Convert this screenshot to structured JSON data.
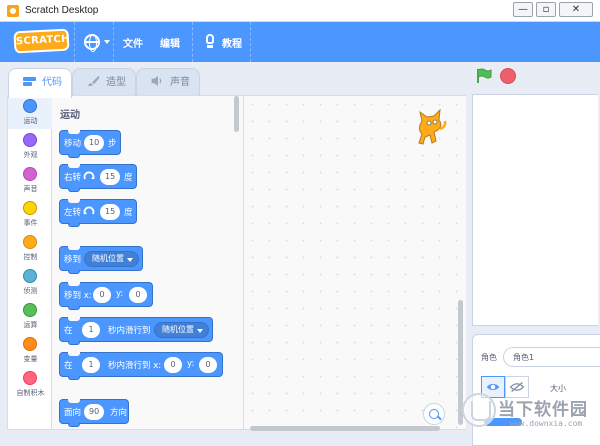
{
  "window": {
    "title": "Scratch Desktop",
    "minimize": "—",
    "maximize": "▫",
    "close": "✕"
  },
  "menubar": {
    "logo": "SCRATCH",
    "file": "文件",
    "edit": "编辑",
    "tutorials": "教程"
  },
  "tabs": [
    {
      "label": "代码"
    },
    {
      "label": "造型"
    },
    {
      "label": "声音"
    }
  ],
  "categories": [
    {
      "label": "运动",
      "color": "#4c97ff"
    },
    {
      "label": "外观",
      "color": "#9966ff"
    },
    {
      "label": "声音",
      "color": "#cf63cf"
    },
    {
      "label": "事件",
      "color": "#ffd500"
    },
    {
      "label": "控制",
      "color": "#ffab19"
    },
    {
      "label": "侦测",
      "color": "#5cb1d6"
    },
    {
      "label": "运算",
      "color": "#59c059"
    },
    {
      "label": "变量",
      "color": "#ff8c1a"
    },
    {
      "label": "自制积木",
      "color": "#ff6680"
    }
  ],
  "palette": {
    "section": "运动",
    "move": {
      "pre": "移动",
      "value": "10",
      "post": "步"
    },
    "turn_right": {
      "pre": "右转",
      "value": "15",
      "post": "度"
    },
    "turn_left": {
      "pre": "左转",
      "value": "15",
      "post": "度"
    },
    "goto": {
      "pre": "移到",
      "dropdown": "随机位置"
    },
    "goto_xy": {
      "pre": "移到 x:",
      "x": "0",
      "mid": "y:",
      "y": "0"
    },
    "glide": {
      "pre": "在",
      "secs": "1",
      "mid": "秒内滑行到",
      "dropdown": "随机位置"
    },
    "glide_xy": {
      "pre": "在",
      "secs": "1",
      "mid": "秒内滑行到 x:",
      "x": "0",
      "ylabel": "y:",
      "y": "0"
    },
    "point": {
      "pre": "面向",
      "value": "90",
      "post": "方向"
    }
  },
  "sprite_info": {
    "sprite_label": "角色",
    "sprite_name": "角色1",
    "size_label": "大小"
  },
  "watermark": {
    "text": "当下软件园",
    "url": "www.downxia.com"
  }
}
